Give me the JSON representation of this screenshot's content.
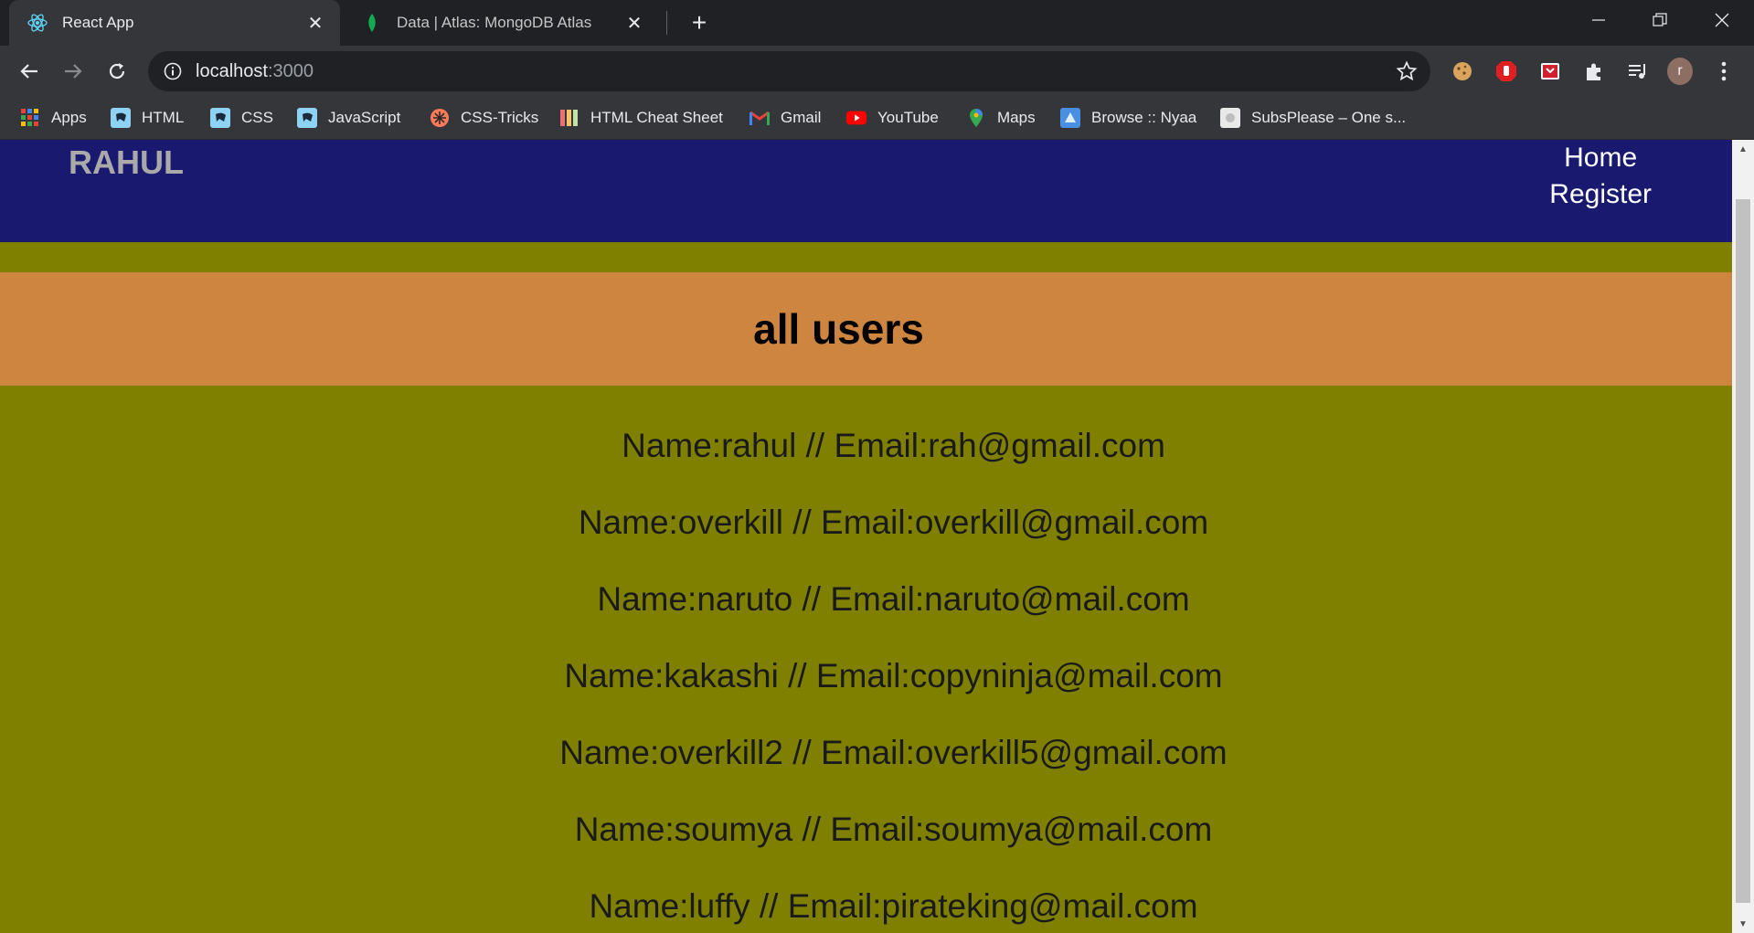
{
  "browser": {
    "tabs": [
      {
        "title": "React App",
        "icon": "react-icon",
        "active": true
      },
      {
        "title": "Data | Atlas: MongoDB Atlas",
        "icon": "mongodb-leaf-icon",
        "active": false
      }
    ],
    "url": {
      "host": "localhost",
      "port": ":3000"
    },
    "bookmarks": [
      {
        "label": "Apps",
        "icon": "apps-grid-icon"
      },
      {
        "label": "HTML",
        "icon": "bookmark-html-icon"
      },
      {
        "label": "CSS",
        "icon": "bookmark-css-icon"
      },
      {
        "label": "JavaScript",
        "icon": "bookmark-javascript-icon"
      },
      {
        "label": "CSS-Tricks",
        "icon": "css-tricks-icon"
      },
      {
        "label": "HTML Cheat Sheet",
        "icon": "cheatsheet-icon"
      },
      {
        "label": "Gmail",
        "icon": "gmail-icon"
      },
      {
        "label": "YouTube",
        "icon": "youtube-icon"
      },
      {
        "label": "Maps",
        "icon": "maps-icon"
      },
      {
        "label": "Browse :: Nyaa",
        "icon": "nyaa-icon"
      },
      {
        "label": "SubsPlease – One s...",
        "icon": "subsplease-icon"
      }
    ],
    "profile_initial": "r"
  },
  "page": {
    "brand": "RAHUL",
    "nav": {
      "home": "Home",
      "register": "Register"
    },
    "heading": "all users",
    "users": [
      "Name:rahul // Email:rah@gmail.com",
      "Name:overkill // Email:overkill@gmail.com",
      "Name:naruto // Email:naruto@mail.com",
      "Name:kakashi // Email:copyninja@mail.com",
      "Name:overkill2 // Email:overkill5@gmail.com",
      "Name:soumya // Email:soumya@mail.com",
      "Name:luffy // Email:pirateking@mail.com"
    ]
  },
  "colors": {
    "navbar": "#191970",
    "page_bg": "#808000",
    "heading_band": "#cd853f",
    "brand": "#a9a9a9"
  }
}
